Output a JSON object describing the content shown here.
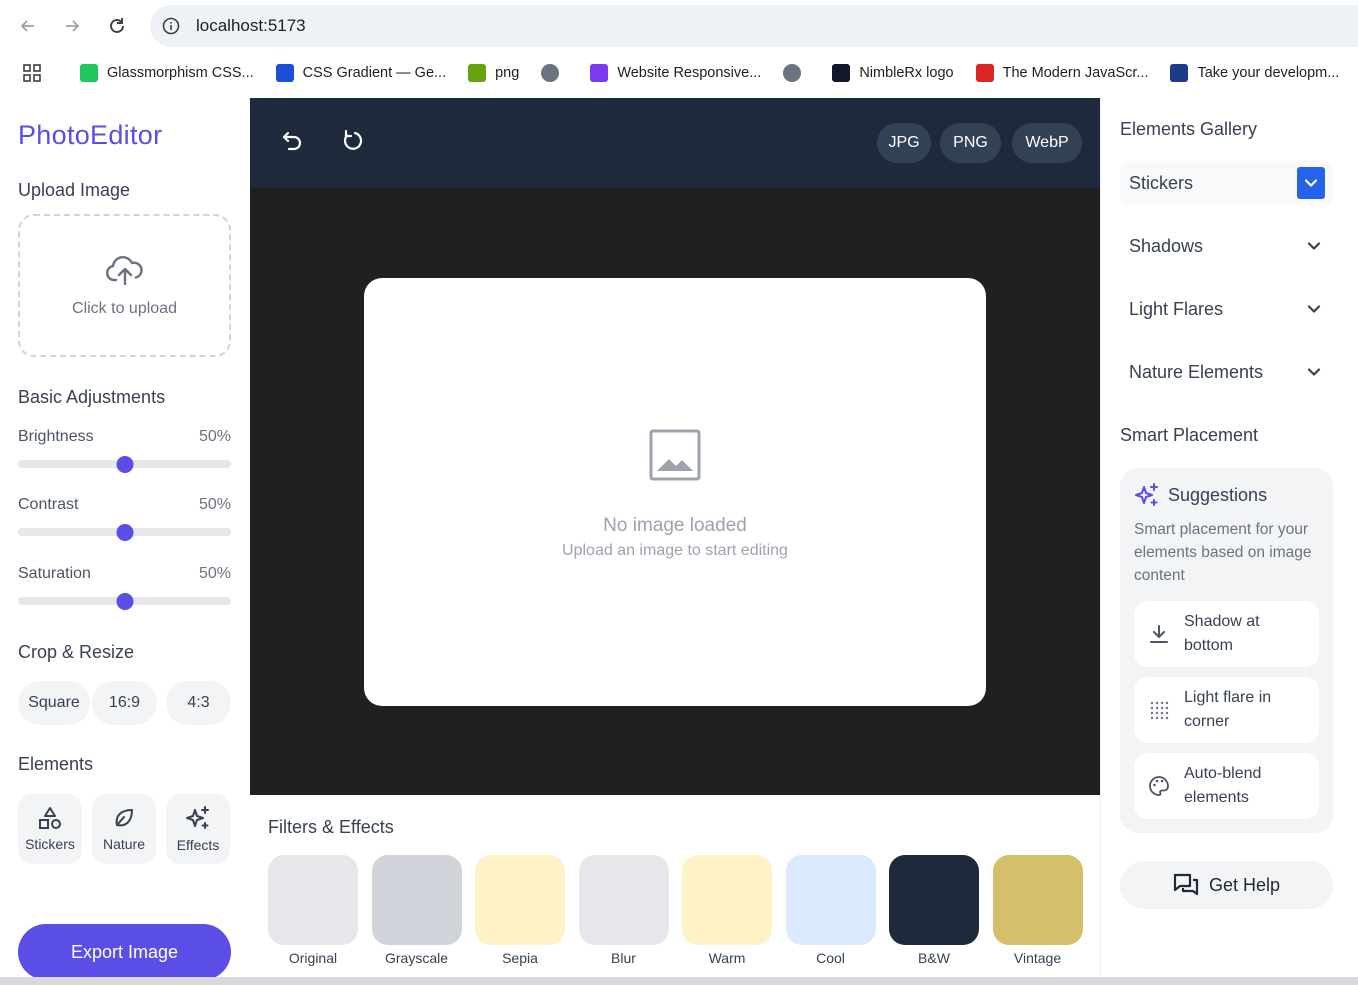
{
  "browser": {
    "url": "localhost:5173",
    "bookmarks": [
      {
        "label": "Glassmorphism CSS...",
        "color": "#22c55e"
      },
      {
        "label": "CSS Gradient — Ge...",
        "color": "#1d4ed8"
      },
      {
        "label": "png",
        "color": "#65a30d"
      },
      {
        "label": "",
        "color": "#6b7280"
      },
      {
        "label": "Website Responsive...",
        "color": "#7c3aed"
      },
      {
        "label": "",
        "color": "#6b7280"
      },
      {
        "label": "NimbleRx logo",
        "color": "#111827"
      },
      {
        "label": "The Modern JavaScr...",
        "color": "#dc2626"
      },
      {
        "label": "Take your developm...",
        "color": "#1e3a8a"
      }
    ]
  },
  "left": {
    "brand": "PhotoEditor",
    "upload_title": "Upload Image",
    "upload_text": "Click to upload",
    "adjust_title": "Basic Adjustments",
    "adjustments": [
      {
        "label": "Brightness",
        "value": "50%",
        "level": 0.5
      },
      {
        "label": "Contrast",
        "value": "50%",
        "level": 0.5
      },
      {
        "label": "Saturation",
        "value": "50%",
        "level": 0.5
      }
    ],
    "crop_title": "Crop & Resize",
    "crop": [
      "Square",
      "16:9",
      "4:3"
    ],
    "elements_title": "Elements",
    "elements": [
      "Stickers",
      "Nature",
      "Effects"
    ],
    "export": "Export Image"
  },
  "toolbar": {
    "formats": [
      "JPG",
      "PNG",
      "WebP"
    ]
  },
  "canvas": {
    "empty_title": "No image loaded",
    "empty_sub": "Upload an image to start editing"
  },
  "filters": {
    "title": "Filters & Effects",
    "items": [
      {
        "label": "Original",
        "color": "#e5e7eb"
      },
      {
        "label": "Grayscale",
        "color": "#d1d5db"
      },
      {
        "label": "Sepia",
        "color": "#fef3c7"
      },
      {
        "label": "Blur",
        "color": "#e5e7eb"
      },
      {
        "label": "Warm",
        "color": "#fef3c7"
      },
      {
        "label": "Cool",
        "color": "#dbeafe"
      },
      {
        "label": "B&W",
        "color": "#1e293b"
      },
      {
        "label": "Vintage",
        "color": "#d4c06a"
      }
    ]
  },
  "right": {
    "gallery_title": "Elements Gallery",
    "categories": [
      "Stickers",
      "Shadows",
      "Light Flares",
      "Nature Elements"
    ],
    "smart_title": "Smart Placement",
    "suggestions_title": "Suggestions",
    "suggestions_desc": "Smart placement for your elements based on image content",
    "suggestions": [
      {
        "label": "Shadow at bottom",
        "icon": "download-icon"
      },
      {
        "label": "Light flare in corner",
        "icon": "dots-grid-icon"
      },
      {
        "label": "Auto-blend elements",
        "icon": "palette-icon"
      }
    ],
    "help": "Get Help"
  },
  "colors": {
    "accent": "#5b4ee6",
    "toolbar": "#1e2a3b",
    "canvas_bg": "#202020"
  }
}
